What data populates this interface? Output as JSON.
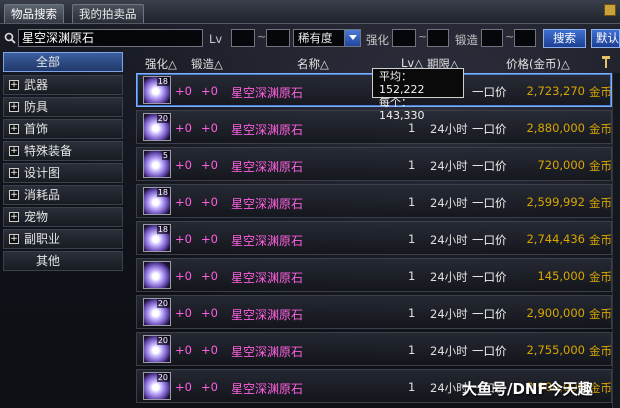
{
  "tabs": [
    "物品搜索",
    "我的拍卖品"
  ],
  "search": {
    "name_value": "星空深渊原石",
    "lv_label": "Lv",
    "tilde": "~",
    "rarity_value": "稀有度",
    "enhance_label": "强化",
    "forge_label": "锻造",
    "search_button": "搜索",
    "default_button": "默认"
  },
  "sidebar": {
    "items": [
      {
        "label": "全部",
        "expandable": false,
        "selected": true
      },
      {
        "label": "武器",
        "expandable": true
      },
      {
        "label": "防具",
        "expandable": true
      },
      {
        "label": "首饰",
        "expandable": true
      },
      {
        "label": "特殊装备",
        "expandable": true
      },
      {
        "label": "设计图",
        "expandable": true
      },
      {
        "label": "消耗品",
        "expandable": true
      },
      {
        "label": "宠物",
        "expandable": true
      },
      {
        "label": "副职业",
        "expandable": true
      },
      {
        "label": "其他",
        "expandable": false
      }
    ],
    "expand_glyph": "+"
  },
  "table": {
    "headers": {
      "enhance": "强化△",
      "forge": "锻造△",
      "name": "名称△",
      "lv": "Lv△",
      "period": "期限△",
      "price": "价格(金币)△"
    },
    "rows": [
      {
        "lv": "18",
        "enhance": "+0",
        "forge": "+0",
        "name": "星空深渊原石",
        "count": "",
        "period": "",
        "type": "一口价",
        "price": "2,723,270",
        "currency": "金币"
      },
      {
        "lv": "20",
        "enhance": "+0",
        "forge": "+0",
        "name": "星空深渊原石",
        "count": "1",
        "period": "24小时",
        "type": "一口价",
        "price": "2,880,000",
        "currency": "金币"
      },
      {
        "lv": "5",
        "enhance": "+0",
        "forge": "+0",
        "name": "星空深渊原石",
        "count": "1",
        "period": "24小时",
        "type": "一口价",
        "price": "720,000",
        "currency": "金币"
      },
      {
        "lv": "18",
        "enhance": "+0",
        "forge": "+0",
        "name": "星空深渊原石",
        "count": "1",
        "period": "24小时",
        "type": "一口价",
        "price": "2,599,992",
        "currency": "金币"
      },
      {
        "lv": "18",
        "enhance": "+0",
        "forge": "+0",
        "name": "星空深渊原石",
        "count": "1",
        "period": "24小时",
        "type": "一口价",
        "price": "2,744,436",
        "currency": "金币"
      },
      {
        "lv": "",
        "enhance": "+0",
        "forge": "+0",
        "name": "星空深渊原石",
        "count": "1",
        "period": "24小时",
        "type": "一口价",
        "price": "145,000",
        "currency": "金币"
      },
      {
        "lv": "20",
        "enhance": "+0",
        "forge": "+0",
        "name": "星空深渊原石",
        "count": "1",
        "period": "24小时",
        "type": "一口价",
        "price": "2,900,000",
        "currency": "金币"
      },
      {
        "lv": "20",
        "enhance": "+0",
        "forge": "+0",
        "name": "星空深渊原石",
        "count": "1",
        "period": "24小时",
        "type": "一口价",
        "price": "2,755,000",
        "currency": "金币"
      },
      {
        "lv": "20",
        "enhance": "+0",
        "forge": "+0",
        "name": "星空深渊原石",
        "count": "1",
        "period": "24小时",
        "type": "一口价",
        "price": "2,900,000",
        "currency": "金币"
      }
    ]
  },
  "tooltip": {
    "avg": "平均：152,222",
    "each": "每个：143,330"
  },
  "watermark": "大鱼号/DNF今天趣",
  "colors": {
    "item_name": "#ff5fe0",
    "price": "#d9a600",
    "accent": "#3f6fd1"
  }
}
